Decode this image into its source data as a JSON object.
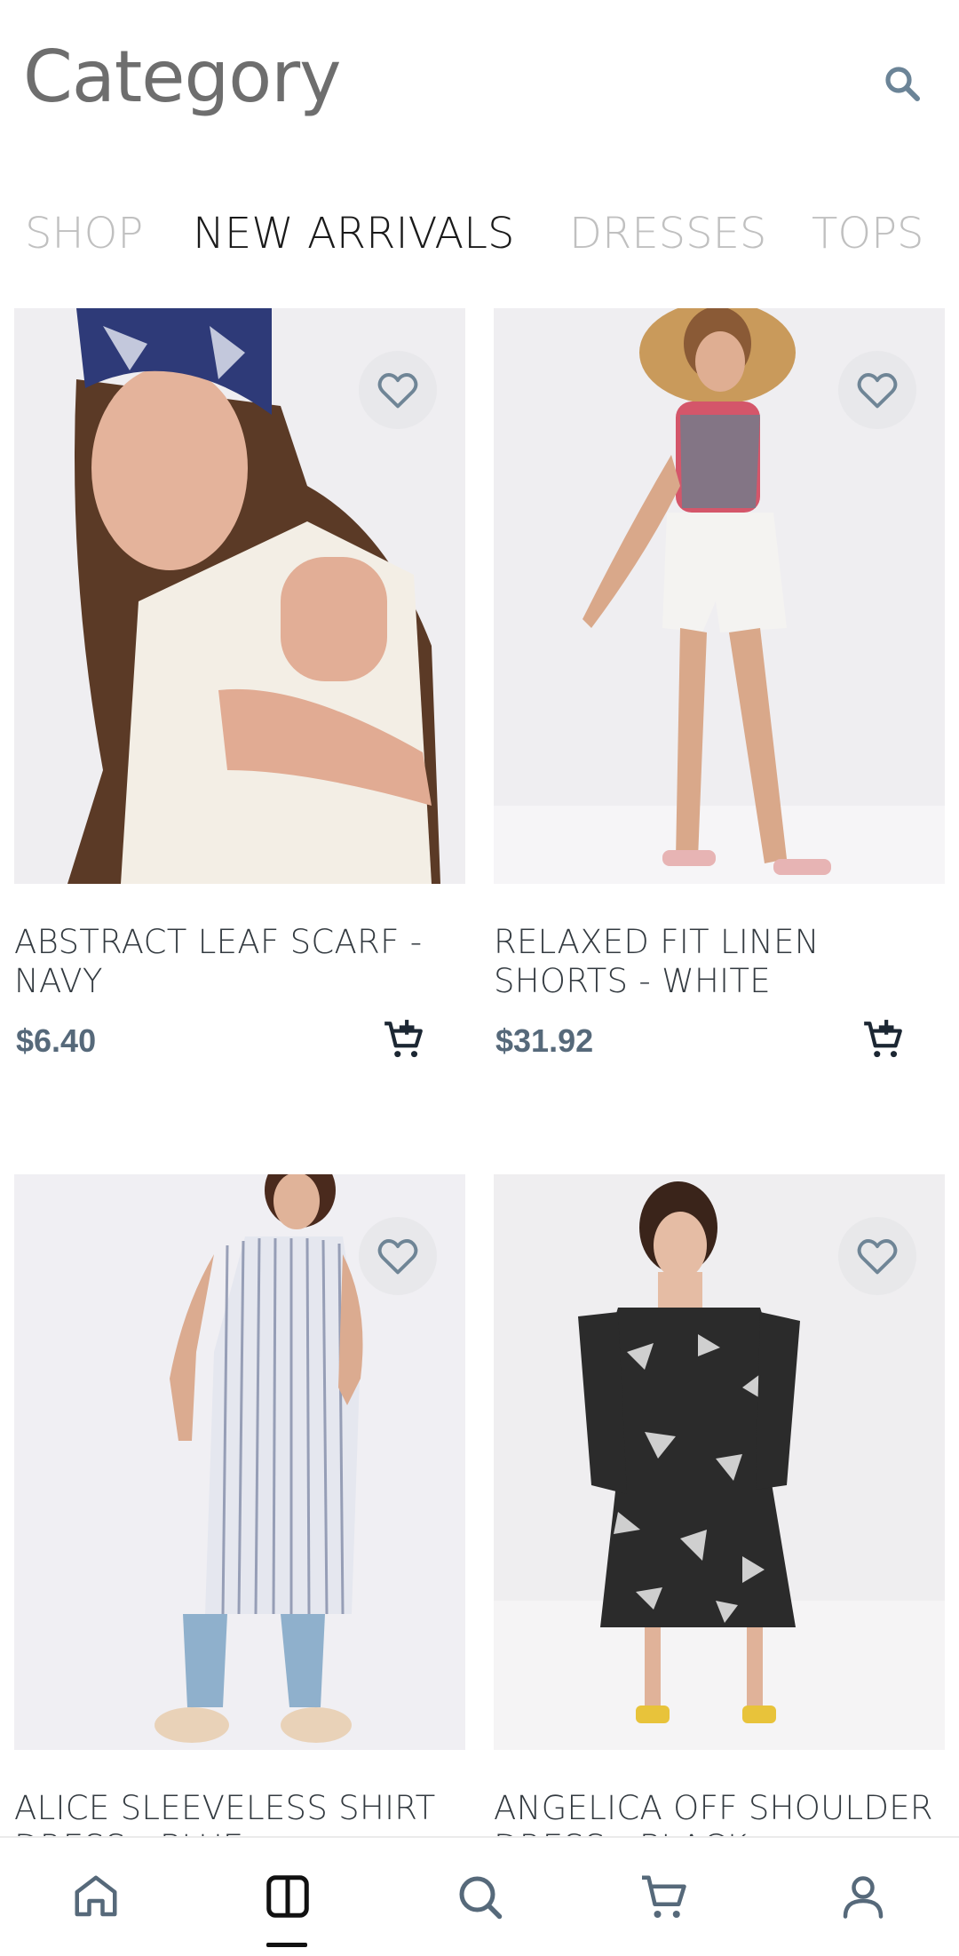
{
  "header": {
    "title": "Category",
    "search_icon": "search-icon"
  },
  "tabs": [
    {
      "label": "SHOP",
      "active": false
    },
    {
      "label": "NEW ARRIVALS",
      "active": true
    },
    {
      "label": "DRESSES",
      "active": false
    },
    {
      "label": "TOPS",
      "active": false
    }
  ],
  "products": [
    {
      "name": "ABSTRACT LEAF SCARF - NAVY",
      "price": "$6.40",
      "fav_icon": "heart-outline-icon",
      "cart_icon": "cart-add-icon"
    },
    {
      "name": "RELAXED FIT LINEN SHORTS - WHITE",
      "price": "$31.92",
      "fav_icon": "heart-outline-icon",
      "cart_icon": "cart-add-icon"
    },
    {
      "name": "ALICE SLEEVELESS SHIRT DRESS - BLUE",
      "price": "",
      "fav_icon": "heart-outline-icon",
      "cart_icon": "cart-add-icon"
    },
    {
      "name": "ANGELICA OFF SHOULDER DRESS - BLACK",
      "price": "",
      "fav_icon": "heart-outline-icon",
      "cart_icon": "cart-add-icon"
    }
  ],
  "bottom_nav": {
    "items": [
      {
        "icon": "home-icon"
      },
      {
        "icon": "category-icon",
        "active": true
      },
      {
        "icon": "search-icon"
      },
      {
        "icon": "cart-icon"
      },
      {
        "icon": "profile-icon"
      }
    ]
  },
  "colors": {
    "price": "#56697a",
    "tab_active": "#1a1a1a",
    "tab_inactive": "#c0c0c0",
    "title": "#6e6e6e",
    "icon": "#56697a"
  }
}
